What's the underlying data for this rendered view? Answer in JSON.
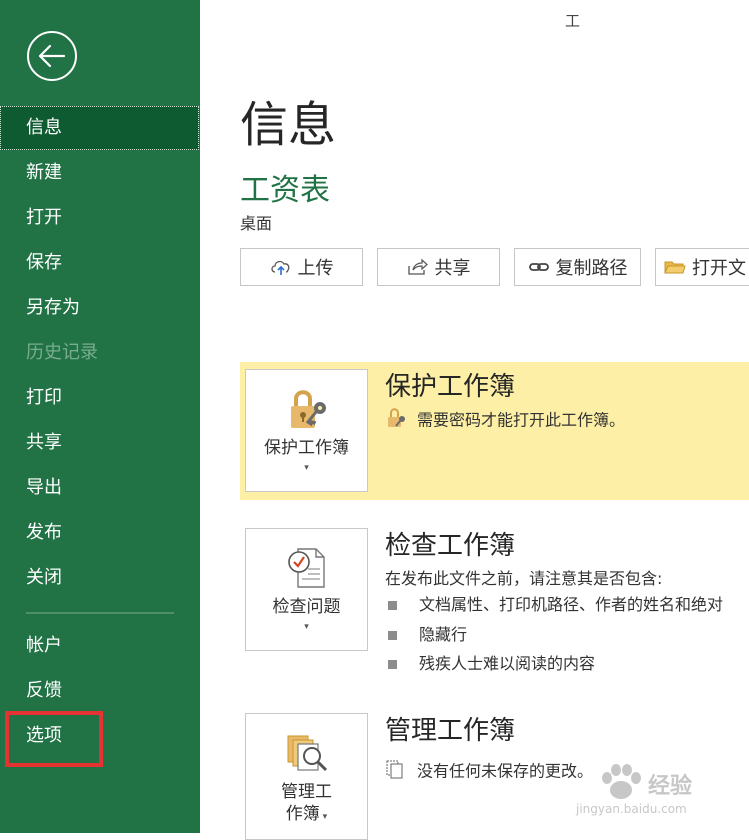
{
  "app": {
    "title": "工"
  },
  "sidebar": {
    "back_icon": "back-arrow-icon",
    "items": [
      {
        "label": "信息",
        "state": "active"
      },
      {
        "label": "新建",
        "state": "normal"
      },
      {
        "label": "打开",
        "state": "normal"
      },
      {
        "label": "保存",
        "state": "normal"
      },
      {
        "label": "另存为",
        "state": "normal"
      },
      {
        "label": "历史记录",
        "state": "disabled"
      },
      {
        "label": "打印",
        "state": "normal"
      },
      {
        "label": "共享",
        "state": "normal"
      },
      {
        "label": "导出",
        "state": "normal"
      },
      {
        "label": "发布",
        "state": "normal"
      },
      {
        "label": "关闭",
        "state": "normal"
      },
      {
        "label": "帐户",
        "state": "normal"
      },
      {
        "label": "反馈",
        "state": "normal"
      },
      {
        "label": "选项",
        "state": "highlighted"
      }
    ]
  },
  "main": {
    "title": "信息",
    "file_name": "工资表",
    "file_location": "桌面",
    "actions": [
      {
        "label": "上传",
        "icon": "cloud-upload-icon"
      },
      {
        "label": "共享",
        "icon": "share-icon"
      },
      {
        "label": "复制路径",
        "icon": "link-icon"
      },
      {
        "label": "打开文",
        "icon": "folder-icon"
      }
    ],
    "protect": {
      "button_label": "保护工作簿",
      "title": "保护工作簿",
      "description": "需要密码才能打开此工作簿。"
    },
    "inspect": {
      "button_label": "检查问题",
      "title": "检查工作簿",
      "description": "在发布此文件之前，请注意其是否包含:",
      "bullets": [
        "文档属性、打印机路径、作者的姓名和绝对",
        "隐藏行",
        "残疾人士难以阅读的内容"
      ]
    },
    "manage": {
      "button_label_line1": "管理工",
      "button_label_line2": "作簿",
      "title": "管理工作簿",
      "description": "没有任何未保存的更改。"
    }
  },
  "watermark": {
    "text": "经验",
    "subtext": "jingyan.baidu.com"
  },
  "colors": {
    "sidebar": "#217346",
    "sidebar_active": "#0e5b32",
    "protect_bg": "#fdf0a6",
    "highlight": "#e53232"
  }
}
